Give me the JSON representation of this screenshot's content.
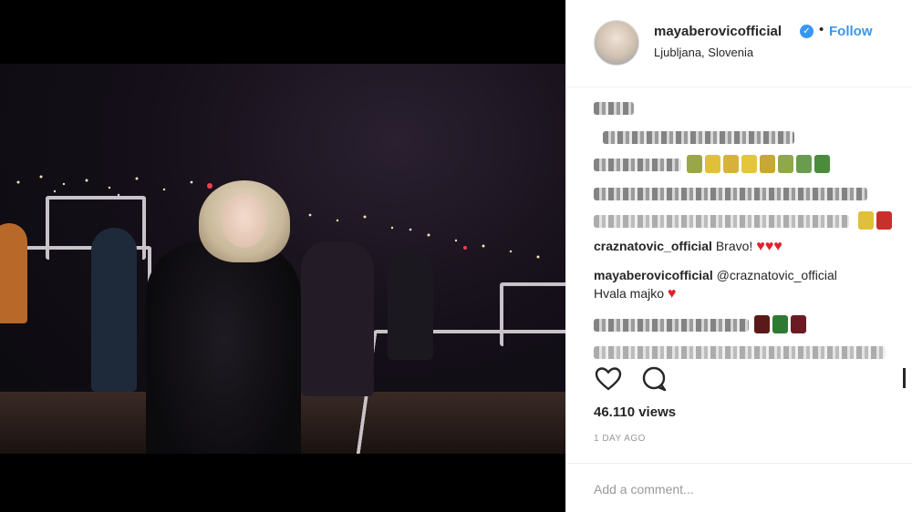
{
  "post": {
    "username": "mayaberovicofficial",
    "verified_icon": "verified-badge-icon",
    "separator": "•",
    "follow_label": "Follow",
    "location": "Ljubljana, Slovenia"
  },
  "comments": [
    {
      "user": "craznatovic_official",
      "text": " Bravo!"
    },
    {
      "user": "mayaberovicofficial",
      "mention": " @craznatovic_official",
      "text": "Hvala majko"
    }
  ],
  "actions": {
    "like_icon": "heart-outline-icon",
    "comment_icon": "comment-bubble-icon"
  },
  "stats": {
    "views": "46.110 views",
    "time_ago": "1 day ago"
  },
  "add_comment": {
    "placeholder": "Add a comment..."
  },
  "colors": {
    "accent": "#3897f0",
    "heart": "#e0212c",
    "text": "#262626",
    "muted": "#999999"
  }
}
